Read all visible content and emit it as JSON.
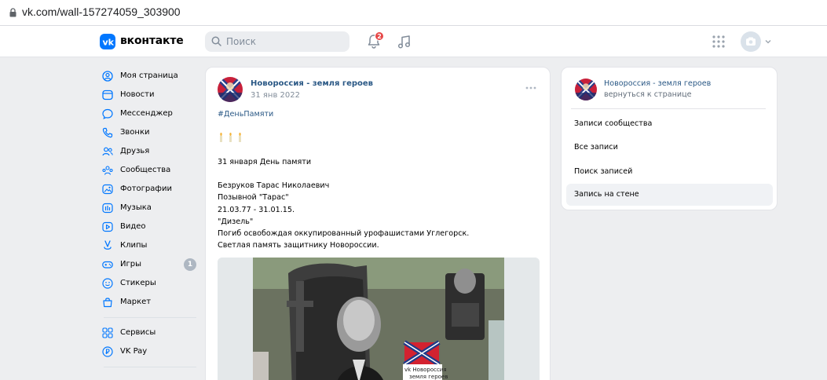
{
  "browser": {
    "url": "vk.com/wall-157274059_303900",
    "icons": {
      "lock": "lock-icon"
    }
  },
  "header": {
    "logo_text": "вконтакте",
    "search_placeholder": "Поиск",
    "notifications_badge": "2",
    "icons": [
      "vk-logo-icon",
      "search-icon",
      "bell-icon",
      "music-icon",
      "apps-grid-icon",
      "camera-icon",
      "chevron-down-icon"
    ],
    "accent": "#0077ff",
    "badge_color": "#e64646"
  },
  "sidebar": {
    "items": [
      {
        "label": "Моя страница",
        "icon": "user-circle-icon"
      },
      {
        "label": "Новости",
        "icon": "news-icon"
      },
      {
        "label": "Мессенджер",
        "icon": "message-icon"
      },
      {
        "label": "Звонки",
        "icon": "phone-icon"
      },
      {
        "label": "Друзья",
        "icon": "friends-icon"
      },
      {
        "label": "Сообщества",
        "icon": "communities-icon"
      },
      {
        "label": "Фотографии",
        "icon": "photo-icon"
      },
      {
        "label": "Музыка",
        "icon": "music-icon"
      },
      {
        "label": "Видео",
        "icon": "video-icon"
      },
      {
        "label": "Клипы",
        "icon": "clips-icon"
      },
      {
        "label": "Игры",
        "icon": "games-icon",
        "count": "1"
      },
      {
        "label": "Стикеры",
        "icon": "sticker-icon"
      },
      {
        "label": "Маркет",
        "icon": "market-icon"
      }
    ],
    "items2": [
      {
        "label": "Сервисы",
        "icon": "services-icon"
      },
      {
        "label": "VK Pay",
        "icon": "vkpay-icon"
      }
    ]
  },
  "post": {
    "author": "Новороссия - земля героев",
    "date": "31 янв 2022",
    "hashtag": "#ДеньПамяти",
    "candles": "🕯🕯🕯",
    "lines": [
      "31 января День памяти",
      "",
      "Безруков Тарас Николаевич",
      "Позывной \"Тарас\"",
      "21.03.77 - 31.01.15.",
      "\"Дизель\"",
      "Погиб освобождая оккупированный урофашистами Углегорск.",
      "Светлая память защитнику Новороссии."
    ],
    "photo_watermark": [
      "vk Новороссия",
      "земля героев"
    ]
  },
  "right_panel": {
    "community_name": "Новороссия - земля героев",
    "back_link": "вернуться к странице",
    "menu": [
      {
        "label": "Записи сообщества",
        "active": false
      },
      {
        "label": "Все записи",
        "active": false
      },
      {
        "label": "Поиск записей",
        "active": false
      },
      {
        "label": "Запись на стене",
        "active": true
      }
    ]
  }
}
